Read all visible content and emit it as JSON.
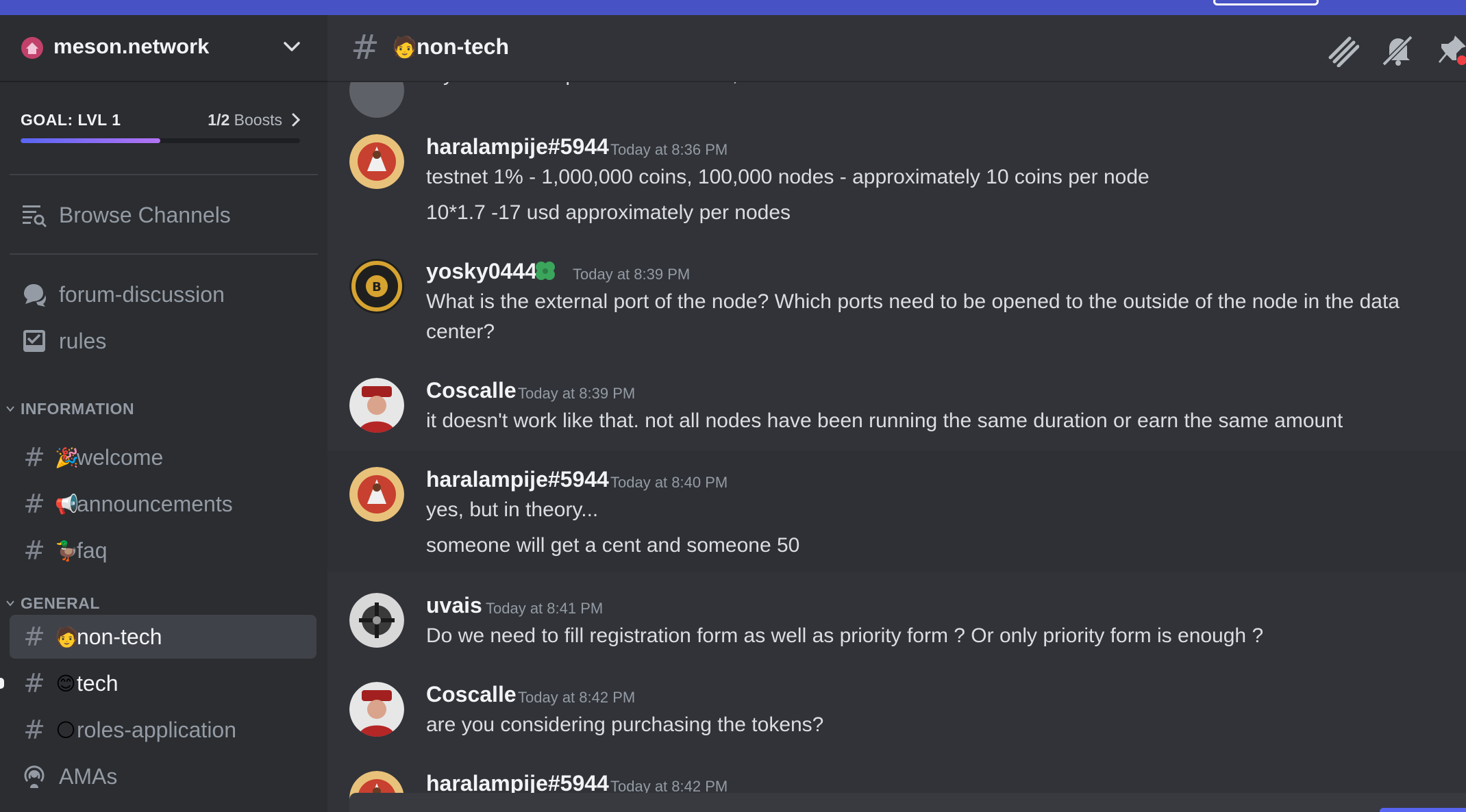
{
  "server": {
    "name": "meson.network",
    "boost_goal": "GOAL: LVL 1",
    "boost_count": "1/2",
    "boost_word": "Boosts",
    "boost_progress": 0.5
  },
  "sidebar": {
    "browse": "Browse Channels",
    "top_items": [
      {
        "label": "forum-discussion",
        "icon": "forum-icon"
      },
      {
        "label": "rules",
        "icon": "rules-checkbox-icon"
      }
    ],
    "categories": [
      {
        "label": "INFORMATION",
        "channels": [
          {
            "emoji": "🎉",
            "label": "welcome"
          },
          {
            "emoji": "📢",
            "label": "announcements"
          },
          {
            "emoji": "🦆",
            "label": "faq"
          }
        ]
      },
      {
        "label": "GENERAL",
        "channels": [
          {
            "emoji": "🧑",
            "label": "non-tech",
            "selected": true
          },
          {
            "emoji": "😊",
            "label": "tech",
            "unread": true
          },
          {
            "emoji": "🌕",
            "label": "roles-application"
          },
          {
            "emoji": "",
            "label": "AMAs",
            "icon": "stage-icon"
          }
        ]
      }
    ]
  },
  "channel": {
    "emoji": "🧑",
    "name": "non-tech",
    "icons": [
      "threads-icon",
      "mute-bell-icon",
      "pin-icon"
    ]
  },
  "messages": {
    "cut_off_line": "My testnet is equal to this number, then the mainnet is this number or less",
    "items": [
      {
        "author": "haralampije#5944",
        "time": "Today at 8:36 PM",
        "lines": [
          "testnet 1% - 1,000,000 coins, 100,000 nodes - approximately 10 coins per node",
          "10*1.7 -17 usd approximately  per nodes"
        ]
      },
      {
        "author": "yosky0444",
        "time": "Today at 8:39 PM",
        "lines": [
          "What is the external port of the node? Which ports need to be opened to the outside of the node in the data",
          "center?"
        ]
      },
      {
        "author": "Coscalle",
        "time": "Today at 8:39 PM",
        "lines": [
          "it doesn't work like that. not all nodes have been running the same duration or earn the same amount"
        ]
      },
      {
        "author": "haralampije#5944",
        "time": "Today at 8:40 PM",
        "lines": [
          "yes, but in theory...",
          "someone will get a cent and someone 50"
        ]
      },
      {
        "author": "uvais",
        "time": "Today at 8:41 PM",
        "lines": [
          "Do we need to fill registration form as well as priority form ? Or only priority form is enough ?"
        ]
      },
      {
        "author": "Coscalle",
        "time": "Today at 8:42 PM",
        "lines": [
          "are you considering purchasing the tokens?"
        ]
      },
      {
        "author": "haralampije#5944",
        "time": "Today at 8:42 PM",
        "lines": []
      }
    ]
  }
}
